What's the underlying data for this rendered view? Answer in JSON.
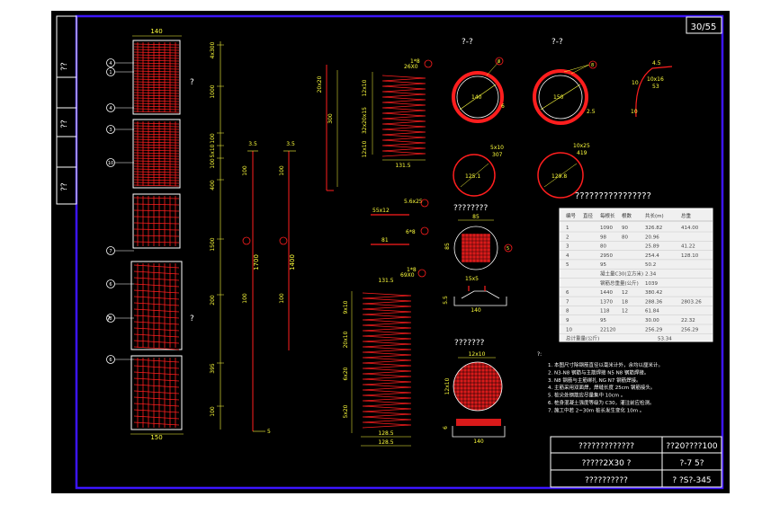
{
  "sheet": {
    "page_number": "30/55",
    "left_strip": [
      "??",
      "??",
      "??"
    ]
  },
  "pile": {
    "top_width": "140",
    "bottom_width": "150",
    "callouts": [
      "4",
      "1",
      "4",
      "3",
      "10",
      "7",
      "6",
      "8",
      "6"
    ],
    "section_marks": [
      "?",
      "?",
      "?"
    ],
    "right_dims": [
      "4x300",
      "1000",
      "100",
      "5x10",
      "100",
      "400",
      "1500",
      "200",
      "395",
      "100"
    ],
    "left_dims": [
      "100",
      "100",
      "100",
      "100"
    ],
    "bar_note_1": "1700",
    "bar_note_2": "1400",
    "tiny": [
      "3.5",
      "3.5",
      "1.5",
      "5"
    ]
  },
  "bars": {
    "b1_top": "1*8",
    "b1_top2": "26X0",
    "b1_dims": [
      "12x10",
      "32x20x15",
      "12x10"
    ],
    "b1_bottom": "131.5",
    "b2_label": "20x20",
    "b2_dim": "300",
    "b3_label": "55x12",
    "b3_top": "5.6x25",
    "b4_top": "6*8",
    "b4_label": "81",
    "b5_top": "1*8",
    "b5_top2": "69X0",
    "b5_width": "131.5",
    "b5_dims": [
      "9x10",
      "20x10",
      "6x20",
      "5x20"
    ],
    "b5_bottom1": "128.5",
    "b5_bottom2": "128.5"
  },
  "sections": {
    "s1_title": "?-?",
    "s1_dim": "140",
    "s1_callouts": [
      "8",
      "6"
    ],
    "s2_title": "?-?",
    "s2_dim": "150",
    "s2_callouts": [
      "8",
      "2.5"
    ],
    "s3_top": "5x10",
    "s3_dim": "125.1",
    "s3_label": "307",
    "s4_top": "10x25",
    "s4_dim": "129.8",
    "s4_label": "419",
    "hook_labels": [
      "4.5",
      "10x16",
      "53",
      "10",
      "10"
    ]
  },
  "bottom": {
    "title1": "????????",
    "dim1": "85",
    "dim2": "85",
    "callout1": "5",
    "under1": "15x5",
    "under2": "140",
    "left1": "5.5",
    "title2": "???????",
    "dim3": "12x10",
    "dim4": "12x10",
    "under3": "140",
    "left2": "6"
  },
  "table": {
    "title": "????????????????",
    "headers": [
      "编号",
      "直径",
      "每根长",
      "根数",
      "共长(m)",
      "总重"
    ],
    "rows": [
      [
        "1",
        "",
        "1090",
        "90",
        "326.82",
        "414.00"
      ],
      [
        "2",
        "",
        "98",
        "80",
        "20.96",
        ""
      ],
      [
        "3",
        "",
        "80",
        "",
        "25.89",
        "41.22"
      ],
      [
        "4",
        "",
        "2950",
        "",
        "254.4",
        "128.10"
      ],
      [
        "5",
        "",
        "95",
        "",
        "50.2",
        ""
      ],
      [
        "",
        "",
        "凝土量C30(立方米)",
        "",
        "2.34",
        ""
      ],
      [
        "",
        "",
        "钢筋总重量(公斤)",
        "",
        "1039",
        ""
      ],
      [
        "6",
        "",
        "1440",
        "12",
        "380.42",
        ""
      ],
      [
        "7",
        "",
        "1370",
        "18",
        "288.36",
        "2803.26"
      ],
      [
        "8",
        "",
        "118",
        "12",
        "61.84",
        ""
      ],
      [
        "9",
        "",
        "95",
        "",
        "30.00",
        "22.32"
      ],
      [
        "10",
        "",
        "22120",
        "",
        "256.29",
        "256.29"
      ]
    ],
    "total_label": "总计重量(公斤)",
    "total_value": "53.34"
  },
  "notes": {
    "head": "?:",
    "lines": [
      "1. 本图尺寸除钢筋直径以毫米计外，余均以厘米计。",
      "2. N3-N8 钢筋与主筋焊接 N5 N8 钢筋焊接。",
      "3. N8 钢筋与主筋绑扎 NG N7 钢筋焊接。",
      "4. 主筋采用双面焊，焊缝长度 25cm 钢筋接头。",
      "5. 桩尖处钢筋应尽量集中 10cm 。",
      "6. 桩身混凝土强度等级为 C30，灌注前应检测。",
      "7. 施工中若 2~30m 桩长发生变化 10m 。"
    ]
  },
  "title_block": {
    "r1_left": "?????????????",
    "r1_right": "??20????100",
    "r2_left": "?????2X30 ?",
    "r2_right": "?-7 5?",
    "r3_left": "??????????",
    "r3_right": "? ?S?-345"
  },
  "colors": {
    "frame": "#3c14ff",
    "rebar": "#ff1e1e",
    "dim": "#ffff3c",
    "text": "#ffffff"
  }
}
